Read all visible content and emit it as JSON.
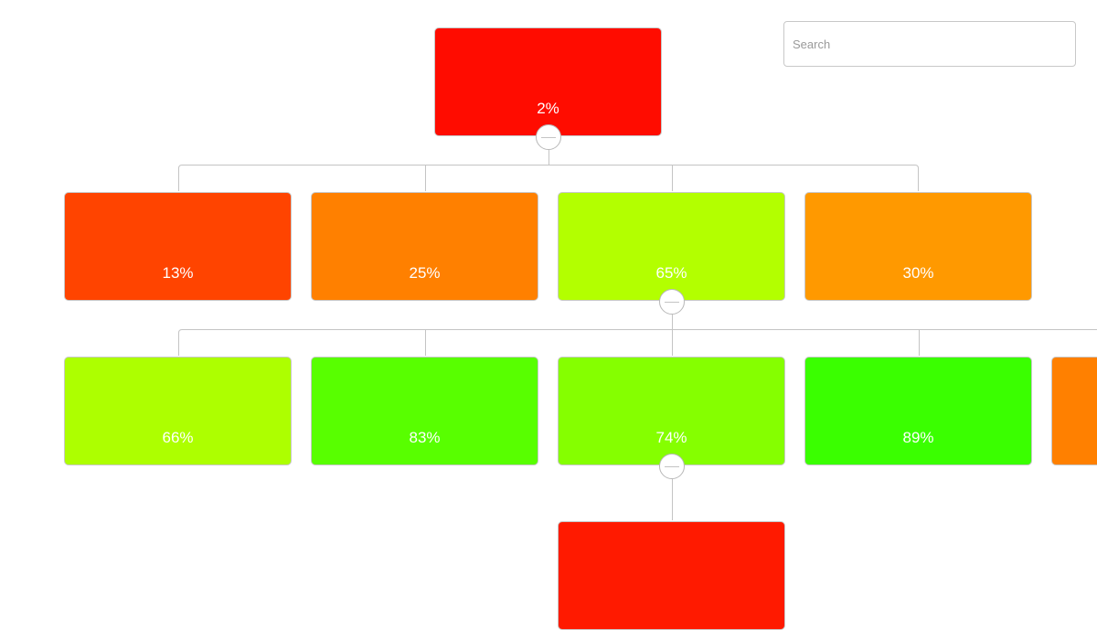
{
  "search": {
    "placeholder": "Search",
    "value": ""
  },
  "tree": {
    "root": {
      "label": "2%",
      "color": "#ff0c00",
      "expanded": true
    },
    "level1": [
      {
        "label": "13%",
        "color": "#ff4400"
      },
      {
        "label": "25%",
        "color": "#ff8000"
      },
      {
        "label": "65%",
        "color": "#b3ff00",
        "expanded": true
      },
      {
        "label": "30%",
        "color": "#ff9900"
      }
    ],
    "level2": [
      {
        "label": "66%",
        "color": "#adff00"
      },
      {
        "label": "83%",
        "color": "#58ff00"
      },
      {
        "label": "74%",
        "color": "#85ff00",
        "expanded": true
      },
      {
        "label": "89%",
        "color": "#3aff00"
      },
      {
        "label": "",
        "color": "#ff8000"
      }
    ],
    "level3": [
      {
        "label": "",
        "color": "#ff1a00"
      }
    ]
  },
  "toggle_icon": "minus-icon"
}
